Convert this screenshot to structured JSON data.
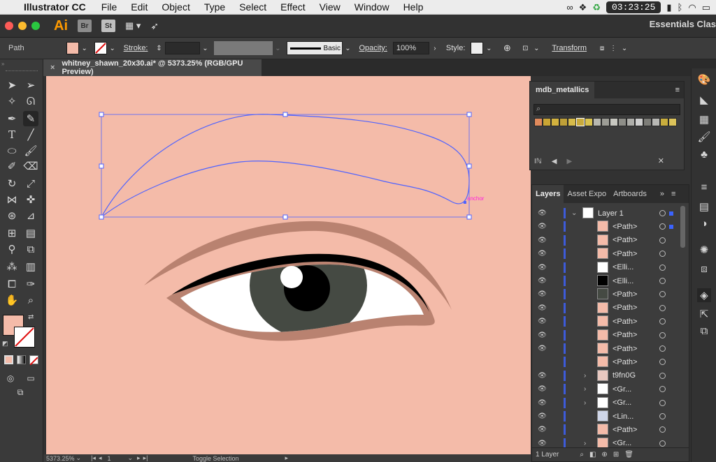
{
  "menubar": {
    "app_name": "Illustrator CC",
    "menus": [
      "File",
      "Edit",
      "Object",
      "Type",
      "Select",
      "Effect",
      "View",
      "Window",
      "Help"
    ],
    "clock": "03:23:25"
  },
  "appbar": {
    "logo": "Ai",
    "bridge_label": "Br",
    "stock_label": "St",
    "workspace": "Essentials Clas"
  },
  "control": {
    "object_type": "Path",
    "stroke_label": "Stroke:",
    "brush_label": "Basic",
    "opacity_label": "Opacity:",
    "opacity_value": "100%",
    "style_label": "Style:",
    "transform_label": "Transform",
    "fill_color": "#f4bba9"
  },
  "document": {
    "tab_title": "whitney_shawn_20x30.ai* @ 5373.25% (RGB/GPU Preview)",
    "anchor_hint": "anchor"
  },
  "status": {
    "zoom": "5373.25%",
    "artboard": "1",
    "tool_hint": "Toggle Selection"
  },
  "mdb_panel": {
    "title": "mdb_metallics",
    "search_placeholder": ""
  },
  "layers_panel": {
    "tabs": [
      "Layers",
      "Asset Expo",
      "Artboards"
    ],
    "rows": [
      {
        "name": "Layer 1"
      },
      {
        "name": "<Path>"
      },
      {
        "name": "<Path>"
      },
      {
        "name": "<Path>"
      },
      {
        "name": "<Elli..."
      },
      {
        "name": "<Elli..."
      },
      {
        "name": "<Path>"
      },
      {
        "name": "<Path>"
      },
      {
        "name": "<Path>"
      },
      {
        "name": "<Path>"
      },
      {
        "name": "<Path>"
      },
      {
        "name": "<Path>"
      },
      {
        "name": "t9fn0G"
      },
      {
        "name": "<Gr..."
      },
      {
        "name": "<Gr..."
      },
      {
        "name": "<Lin..."
      },
      {
        "name": "<Path>"
      },
      {
        "name": "<Gr..."
      }
    ],
    "footer": "1 Layer"
  }
}
